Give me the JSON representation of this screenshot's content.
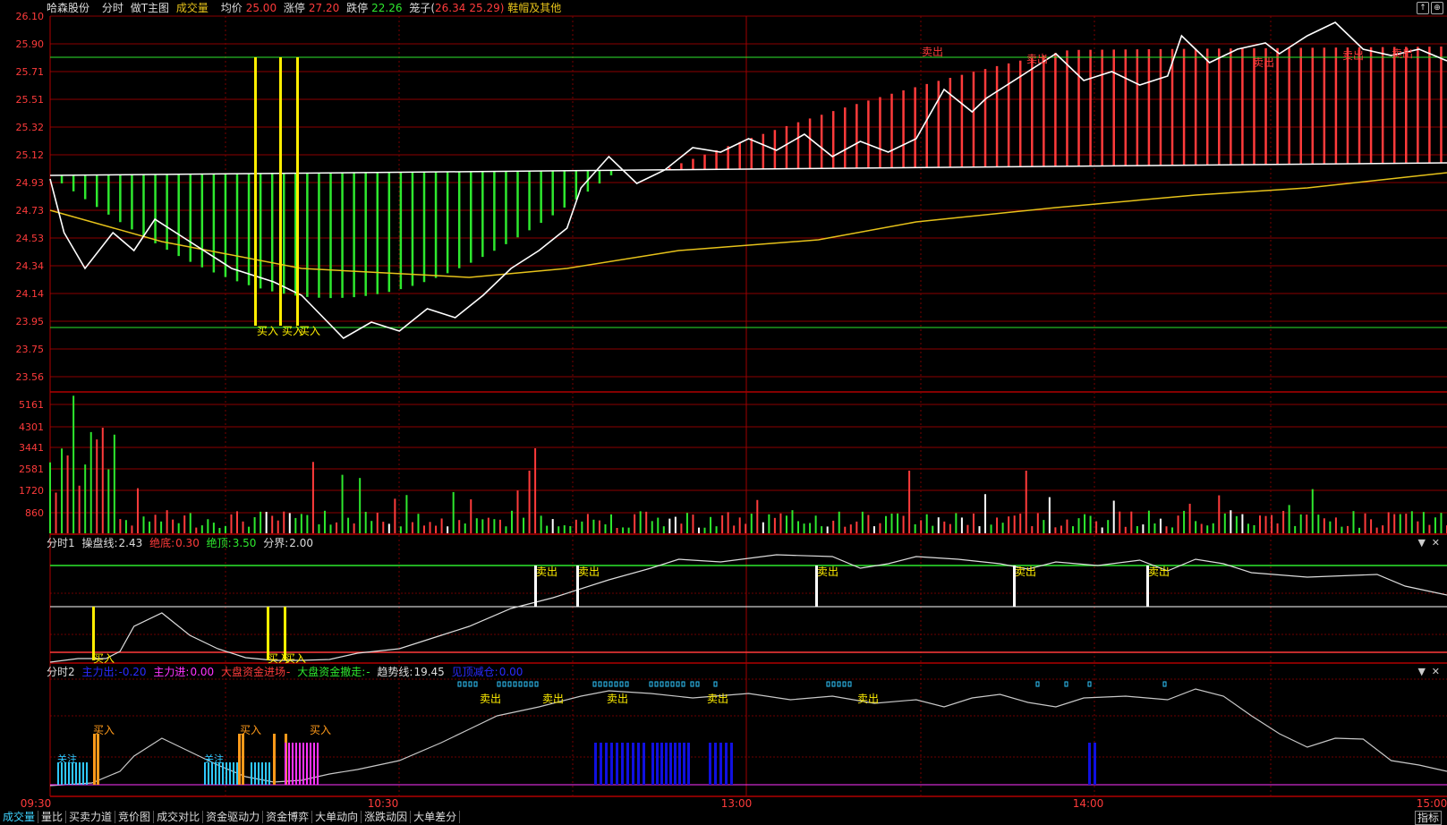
{
  "header": {
    "stock_name": "哈森股份",
    "tab_fenshi": "分时",
    "main_indicator": "做T主图",
    "volume_label": "成交量",
    "avg_label": "均价",
    "avg_value": "25.00",
    "limit_up_label": "涨停",
    "limit_up_value": "27.20",
    "limit_down_label": "跌停",
    "limit_down_value": "22.26",
    "cage_label": "笼子(",
    "cage_high": "26.34",
    "cage_low": "25.29)",
    "category": "鞋帽及其他"
  },
  "price_axis": [
    "26.10",
    "25.90",
    "25.71",
    "25.51",
    "25.32",
    "25.12",
    "24.93",
    "24.73",
    "24.53",
    "24.34",
    "24.14",
    "23.95",
    "23.75",
    "23.56"
  ],
  "volume_axis": [
    "5161",
    "4301",
    "3441",
    "2581",
    "1720",
    "860"
  ],
  "time_axis": [
    "09:30",
    "10:30",
    "13:00",
    "14:00",
    "15:00"
  ],
  "signals": {
    "buy": "买入",
    "sell": "卖出",
    "watch": "关注"
  },
  "sub1": {
    "name": "分时1",
    "line_label": "操盘线:",
    "line_value": "2.43",
    "bottom_label": "绝底:",
    "bottom_value": "0.30",
    "top_label": "绝顶:",
    "top_value": "3.50",
    "divide_label": "分界:",
    "divide_value": "2.00"
  },
  "sub2": {
    "name": "分时2",
    "main_out_label": "主力出:",
    "main_out_value": "-0.20",
    "main_in_label": "主力进:",
    "main_in_value": "0.00",
    "big_in_label": "大盘资金进场",
    "big_in_value": "-",
    "big_out_label": "大盘资金撤走:",
    "big_out_value": "-",
    "trend_label": "趋势线:",
    "trend_value": "19.45",
    "reduce_label": "见顶减仓:",
    "reduce_value": "0.00"
  },
  "bottom_tabs": [
    "成交量",
    "量比",
    "买卖力道",
    "竞价图",
    "成交对比",
    "资金驱动力",
    "资金博弈",
    "大单动向",
    "涨跌动因",
    "大单差分"
  ],
  "right_button": "指标",
  "colors": {
    "up": "#ff3b3b",
    "down": "#2ee82e",
    "grid": "#8b0000",
    "price_line": "#ffffff",
    "avg_line": "#e6c21a",
    "signal_yellow": "#ffee00",
    "blue_bar": "#1010e0",
    "cyan": "#30c8ff"
  }
}
